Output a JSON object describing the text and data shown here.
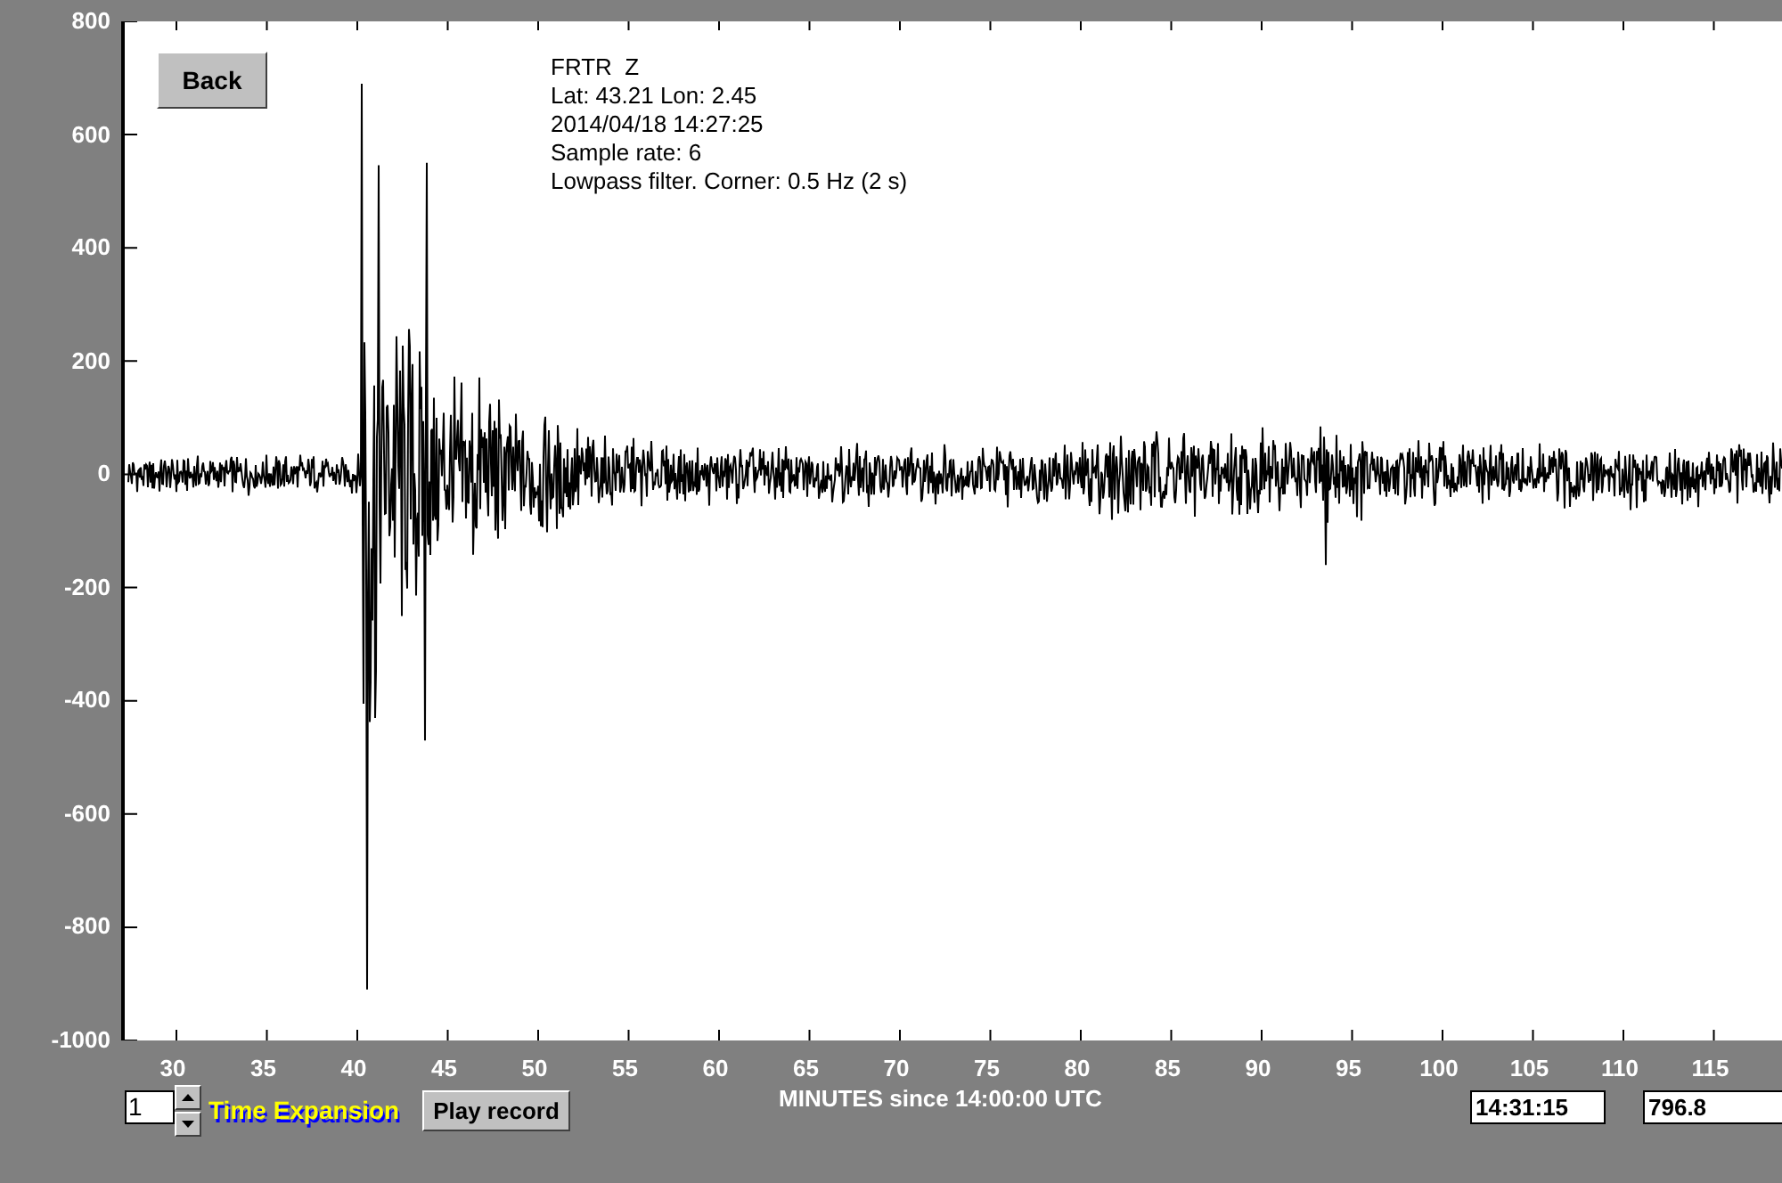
{
  "back_button": "Back",
  "station_info": [
    "FRTR  Z",
    "Lat: 43.21 Lon: 2.45",
    "2014/04/18 14:27:25",
    "Sample rate: 6",
    "Lowpass filter. Corner: 0.5 Hz (2 s)"
  ],
  "y_axis": {
    "tick_labels": [
      "800",
      "600",
      "400",
      "200",
      "0",
      "-200",
      "-400",
      "-600",
      "-800",
      "-1000"
    ]
  },
  "x_axis": {
    "tick_labels": [
      "30",
      "35",
      "40",
      "45",
      "50",
      "55",
      "60",
      "65",
      "70",
      "75",
      "80",
      "85",
      "90",
      "95",
      "100",
      "105",
      "110",
      "115"
    ],
    "title": "MINUTES since 14:00:00 UTC"
  },
  "time_expansion": {
    "value": "1",
    "label": "Time Expansion"
  },
  "play_button": "Play record",
  "cursor_time": "14:31:15",
  "cursor_value": "796.8"
}
